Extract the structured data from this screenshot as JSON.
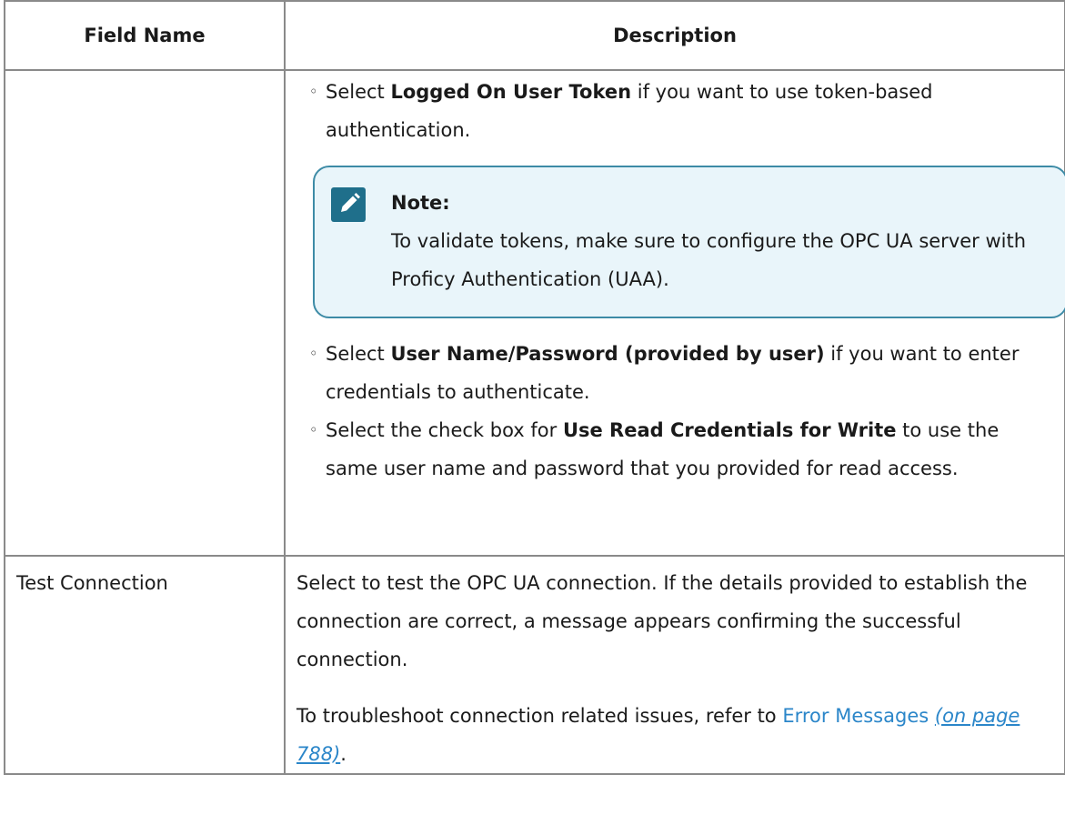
{
  "table": {
    "headers": {
      "field_name": "Field Name",
      "description": "Description"
    },
    "row1": {
      "bullet_marker": "◦",
      "bullet1": {
        "prefix": "Select ",
        "bold": "Logged On User Token",
        "suffix": " if you want to use token-based authentication."
      },
      "note": {
        "icon": "pencil-icon",
        "title": "Note:",
        "text": "To validate tokens, make sure to configure the OPC UA server with Proficy Authentication (UAA)."
      },
      "bullet2": {
        "prefix": "Select ",
        "bold": "User Name/Password (provided by user)",
        "suffix": " if you want to enter credentials to authenticate."
      },
      "bullet3": {
        "prefix": "Select the check box for ",
        "bold": "Use Read Credentials for Write",
        "suffix": " to use the same user name and password that you provided for read access."
      }
    },
    "row2": {
      "field": "Test Connection",
      "para1": "Select to test the OPC UA connection. If the details provided to estab­lish the connection are correct, a message appears confirming the suc­cessful connection.",
      "para2_prefix": "To troubleshoot connection related issues, refer to ",
      "link_text": "Error Messages",
      "link_page": "(on page 788)",
      "para2_suffix": "."
    }
  },
  "colors": {
    "border": "#8a8a8a",
    "note_border": "#3d8ba6",
    "note_bg": "#e9f5fa",
    "note_icon_bg": "#1f6f8b",
    "link": "#2b86c9"
  }
}
